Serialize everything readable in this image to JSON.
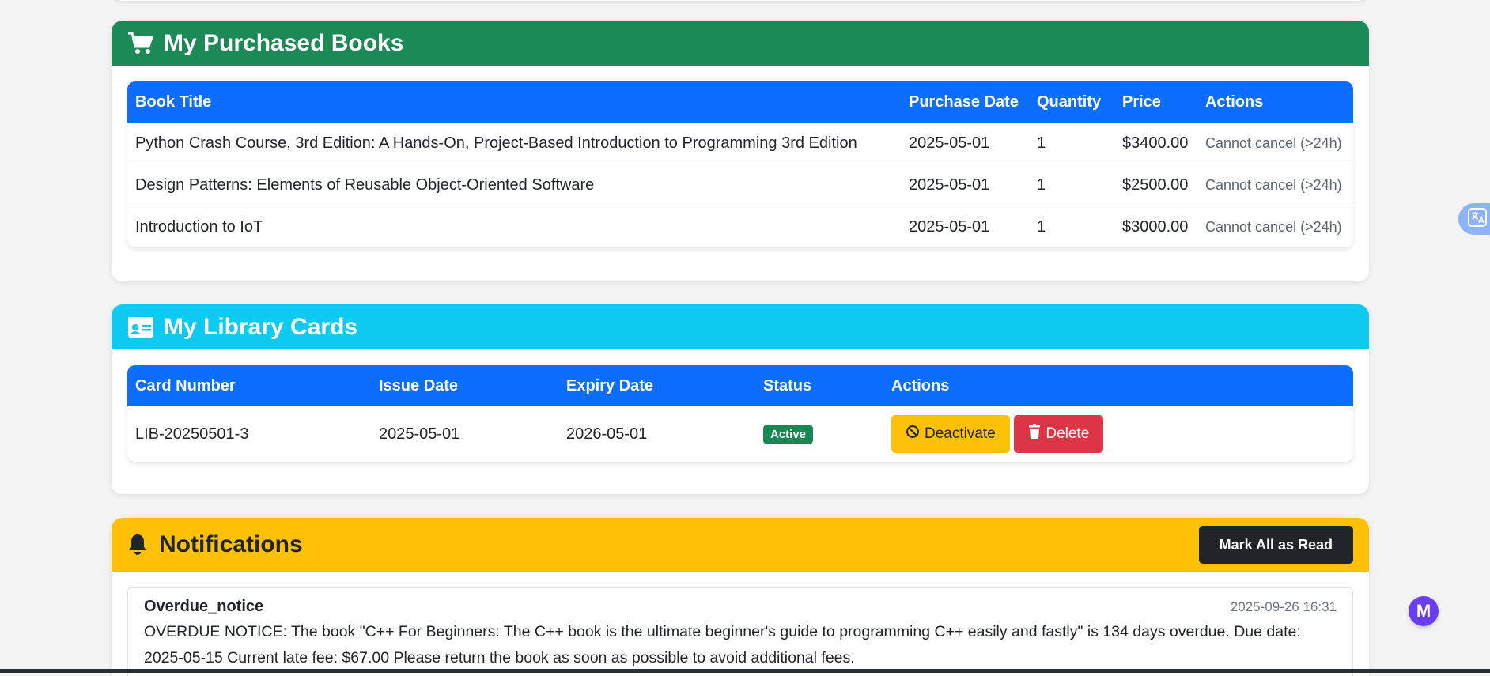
{
  "purchased": {
    "title": "My Purchased Books",
    "header_color": "#198754",
    "columns": [
      "Book Title",
      "Purchase Date",
      "Quantity",
      "Price",
      "Actions"
    ],
    "rows": [
      {
        "title": "Python Crash Course, 3rd Edition: A Hands-On, Project-Based Introduction to Programming 3rd Edition",
        "date": "2025-05-01",
        "qty": "1",
        "price": "$3400.00",
        "action": "Cannot cancel (>24h)"
      },
      {
        "title": "Design Patterns: Elements of Reusable Object-Oriented Software",
        "date": "2025-05-01",
        "qty": "1",
        "price": "$2500.00",
        "action": "Cannot cancel (>24h)"
      },
      {
        "title": "Introduction to IoT",
        "date": "2025-05-01",
        "qty": "1",
        "price": "$3000.00",
        "action": "Cannot cancel (>24h)"
      }
    ]
  },
  "library_cards": {
    "title": "My Library Cards",
    "header_color": "#0dcaf0",
    "columns": [
      "Card Number",
      "Issue Date",
      "Expiry Date",
      "Status",
      "Actions"
    ],
    "rows": [
      {
        "number": "LIB-20250501-3",
        "issue": "2025-05-01",
        "expiry": "2026-05-01",
        "status": "Active",
        "deactivate_label": "Deactivate",
        "delete_label": "Delete"
      }
    ]
  },
  "notifications": {
    "title": "Notifications",
    "header_color": "#ffc107",
    "mark_all_label": "Mark All as Read",
    "items": [
      {
        "type": "Overdue_notice",
        "time": "2025-09-26 16:31",
        "message": "OVERDUE NOTICE: The book \"C++ For Beginners: The C++ book is the ultimate beginner's guide to programming C++ easily and fastly\" is 134 days overdue. Due date: 2025-05-15 Current late fee: $67.00 Please return the book as soon as possible to avoid additional fees."
      }
    ]
  },
  "widgets": {
    "assistant_letter": "M"
  }
}
